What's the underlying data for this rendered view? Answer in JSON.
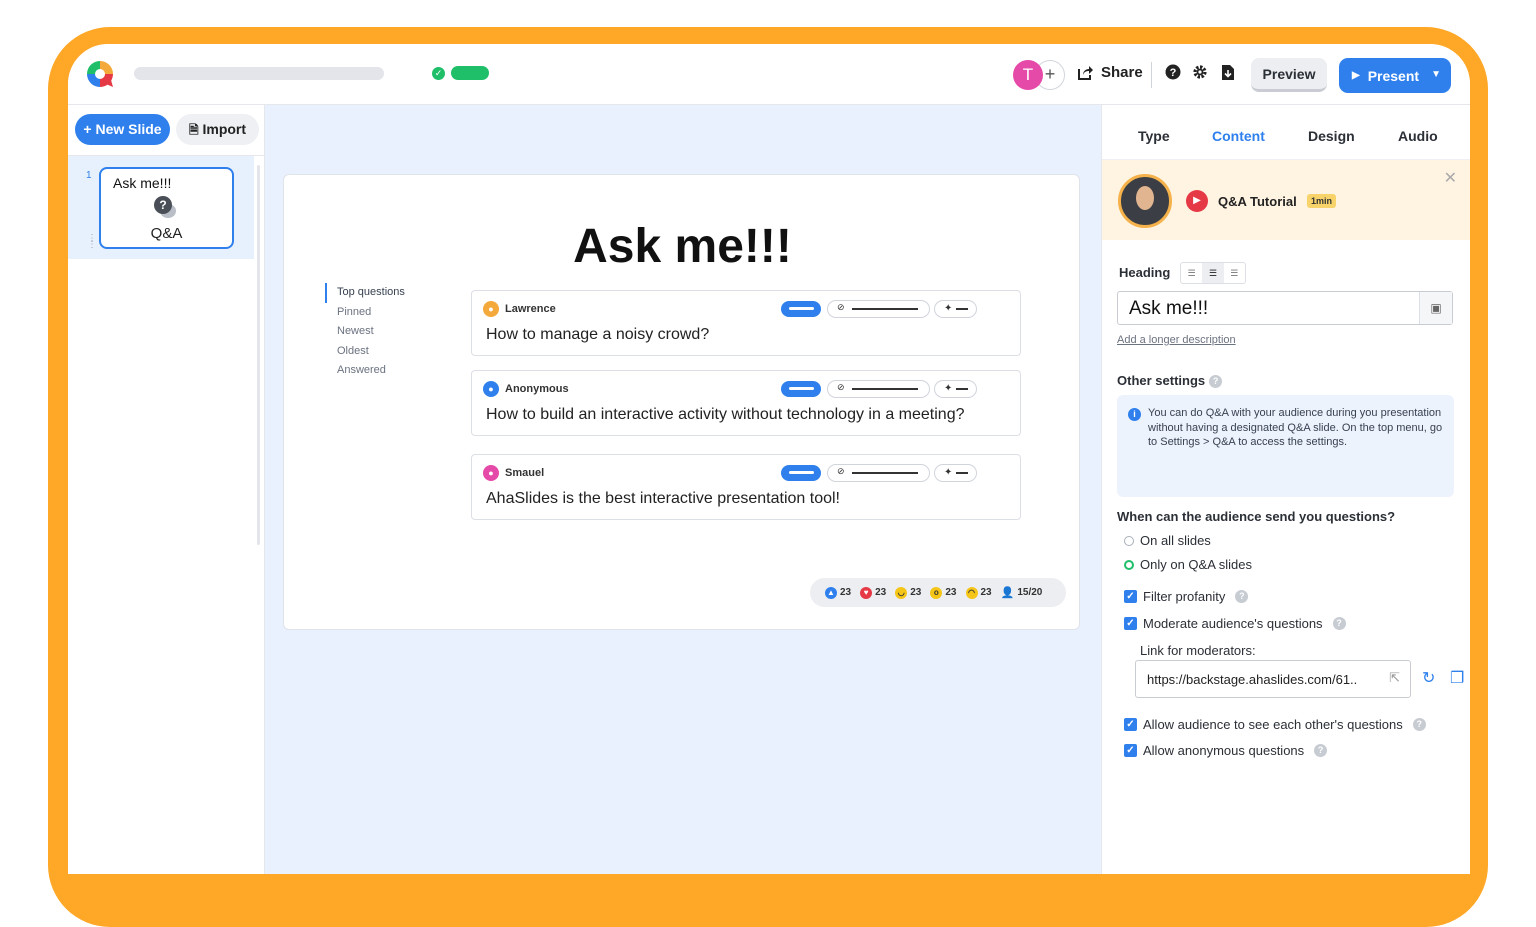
{
  "topbar": {
    "share_label": "Share",
    "avatar_initial": "T",
    "avatar_add": "+",
    "preview_label": "Preview",
    "present_label": "Present"
  },
  "sidebar": {
    "new_slide_label": "+ New Slide",
    "import_label": "Import",
    "slides": [
      {
        "number": "1",
        "title": "Ask me!!!",
        "type_label": "Q&A"
      }
    ]
  },
  "slide": {
    "heading": "Ask me!!!",
    "sort_options": [
      "Top questions",
      "Pinned",
      "Newest",
      "Oldest",
      "Answered"
    ],
    "active_sort": "Top questions",
    "questions": [
      {
        "author": "Lawrence",
        "avatar_color": "#f4a93b",
        "text": "How to manage a noisy crowd?"
      },
      {
        "author": "Anonymous",
        "avatar_color": "#2f80ed",
        "text": "How to build an interactive activity without technology in a meeting?"
      },
      {
        "author": "Smauel",
        "avatar_color": "#e64aa8",
        "text": "AhaSlides is the best interactive presentation tool!"
      }
    ],
    "reactions": [
      {
        "icon": "thumbs-up-icon",
        "count": "23"
      },
      {
        "icon": "heart-icon",
        "count": "23"
      },
      {
        "icon": "laugh-icon",
        "count": "23"
      },
      {
        "icon": "wow-icon",
        "count": "23"
      },
      {
        "icon": "sad-icon",
        "count": "23"
      }
    ],
    "participants": "15/20"
  },
  "panel": {
    "tabs": [
      "Type",
      "Content",
      "Design",
      "Audio"
    ],
    "active_tab": "Content",
    "tutorial_title": "Q&A Tutorial",
    "tutorial_badge": "1min",
    "heading_label": "Heading",
    "heading_value": "Ask me!!!",
    "longer_desc": "Add a longer description",
    "other_settings": "Other settings",
    "info_text": "You can do Q&A with your audience during you presentation without having a designated Q&A slide. On the top menu, go to Settings > Q&A to access the settings.",
    "when_label": "When can the audience send you questions?",
    "radio_all": "On all slides",
    "radio_qa": "Only on Q&A slides",
    "filter_profanity": "Filter profanity",
    "moderate": "Moderate audience's questions",
    "link_label": "Link for moderators:",
    "link_value": "https://backstage.ahaslides.com/61..",
    "allow_see": "Allow audience to see each other's questions",
    "allow_anon": "Allow anonymous questions"
  },
  "colors": {
    "frame": "#FFA726",
    "accent": "#2f80ed",
    "success": "#1fbf6a"
  }
}
